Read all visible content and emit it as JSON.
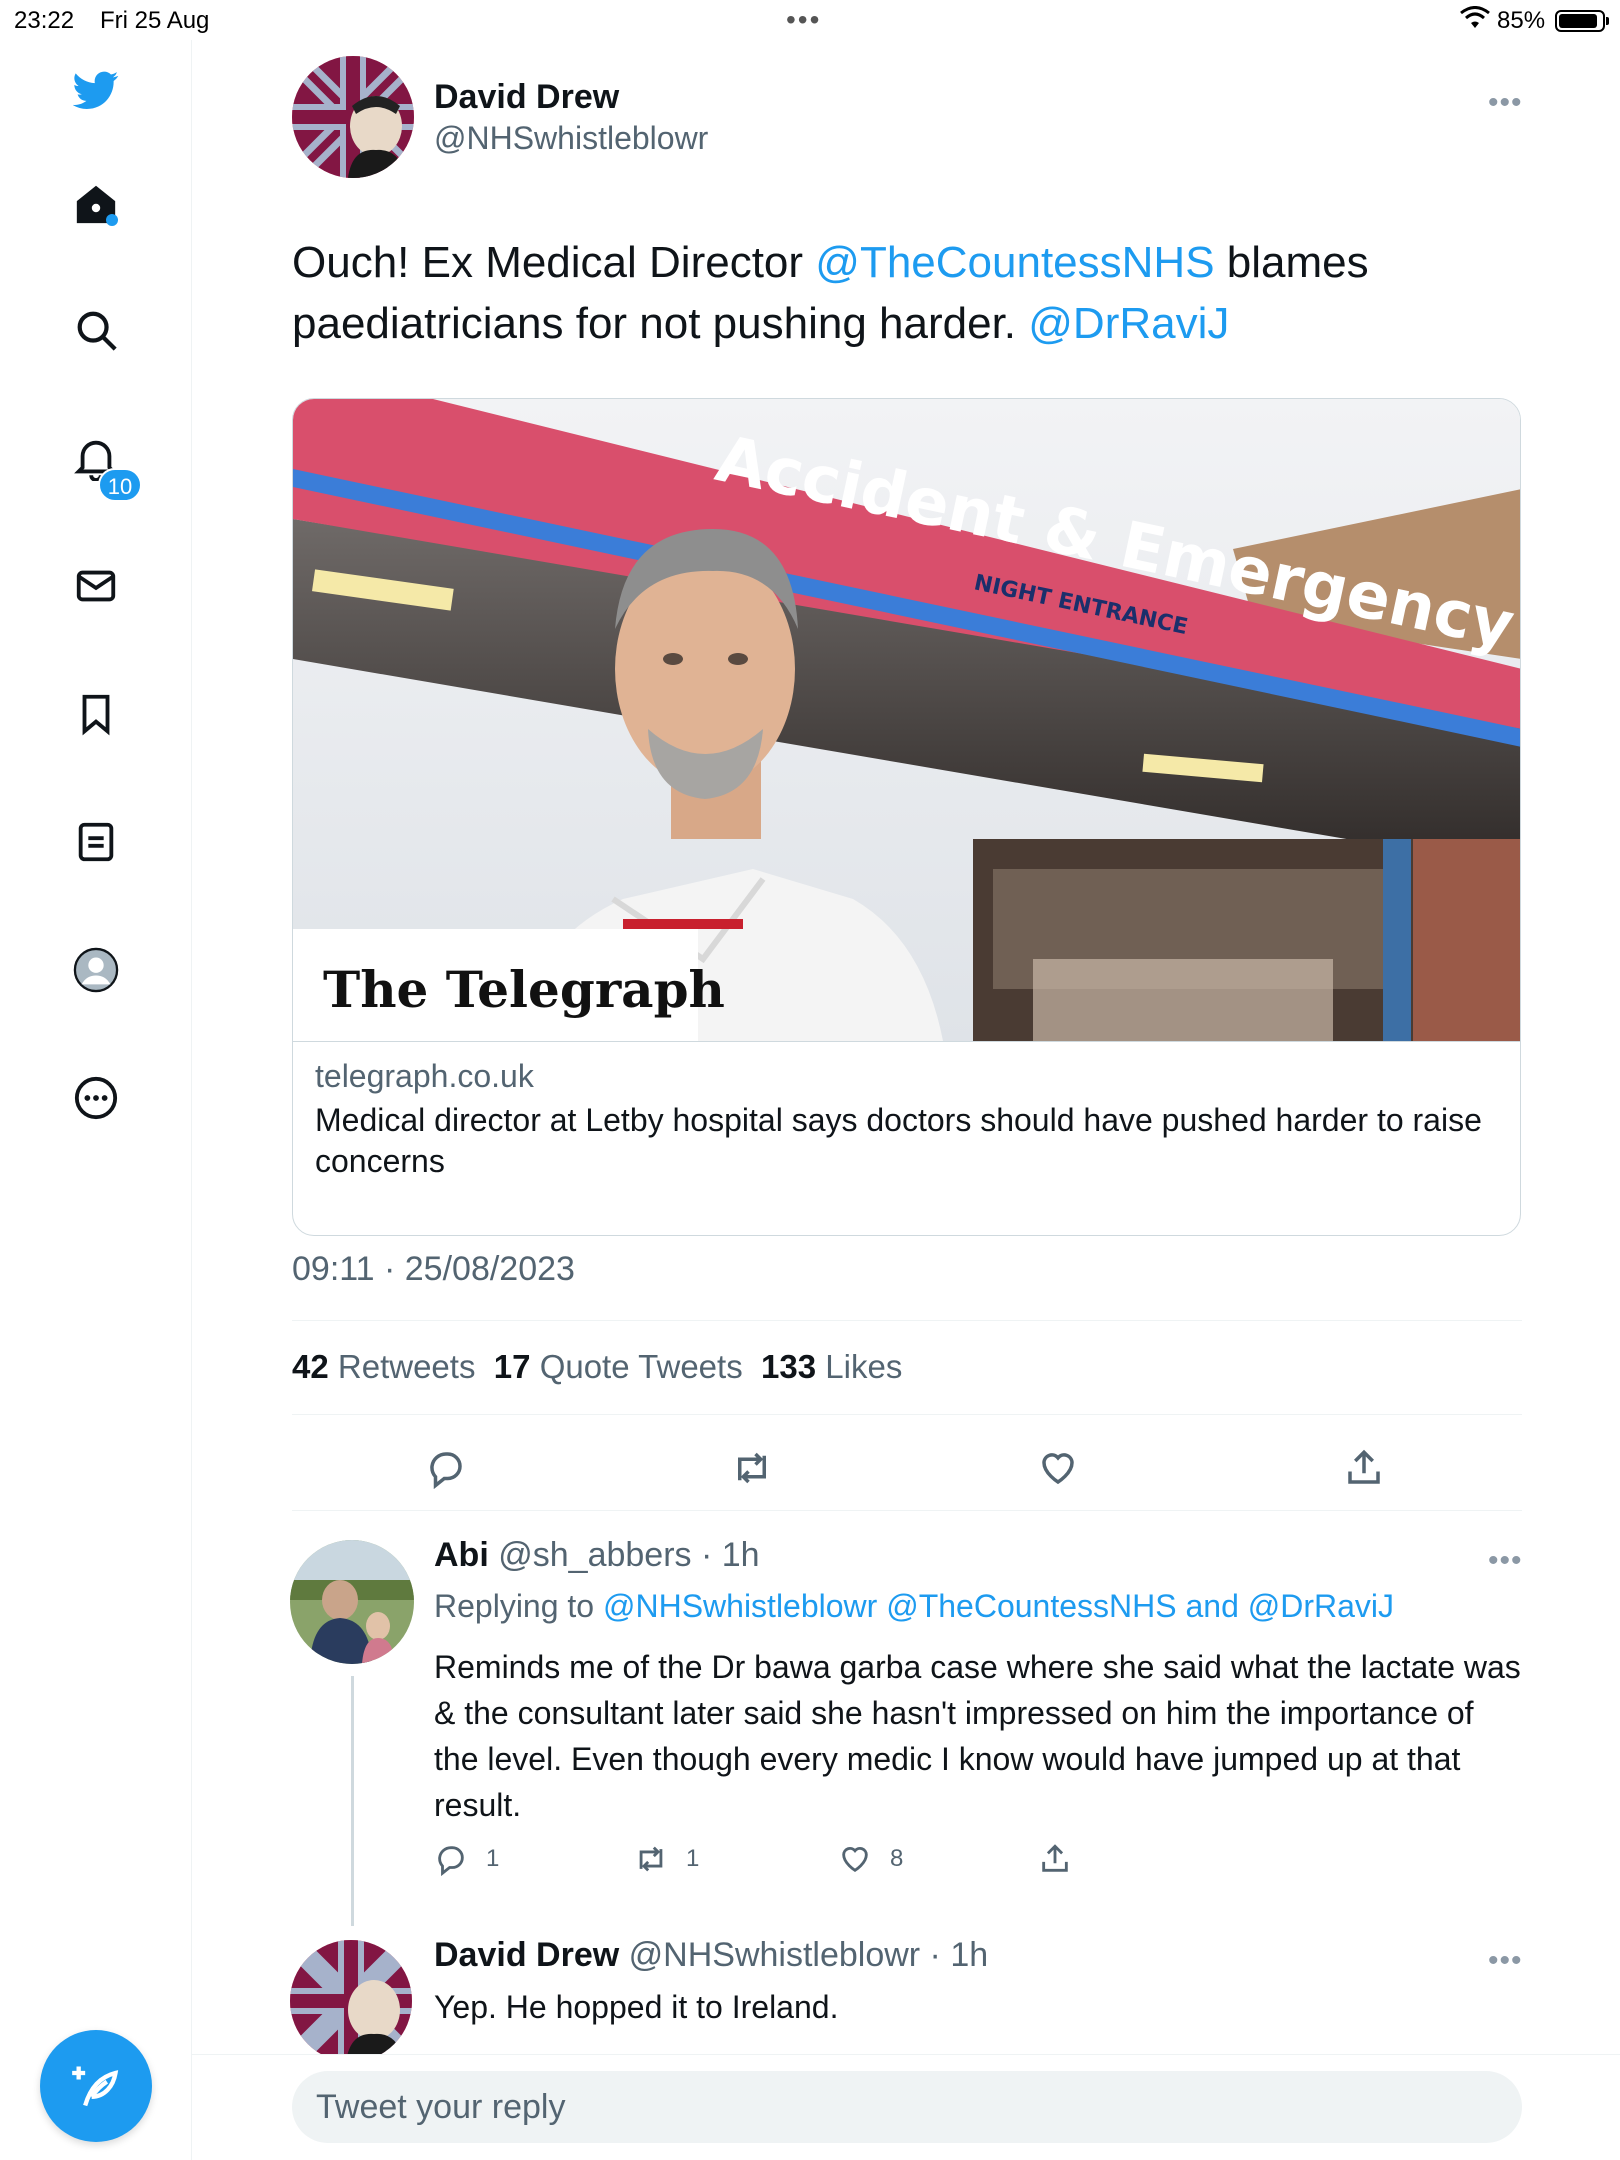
{
  "status_bar": {
    "time": "23:22",
    "date": "Fri 25 Aug",
    "battery": "85%"
  },
  "sidebar": {
    "notifications_badge": "10"
  },
  "tweet": {
    "author_name": "David Drew",
    "author_handle": "@NHSwhistleblowr",
    "text_1": "Ouch! Ex Medical Director ",
    "mention_1": "@TheCountessNHS",
    "text_2": " blames paediatricians for not pushing harder. ",
    "mention_2": "@DrRaviJ",
    "card": {
      "image_sign": "Accident & Emergency",
      "image_subsign": "NIGHT ENTRANCE",
      "image_logo": "The Telegraph",
      "domain": "telegraph.co.uk",
      "title": "Medical director at Letby hospital says doctors should have pushed harder to raise concerns"
    },
    "timestamp": "09:11 · 25/08/2023",
    "stats": {
      "retweets_count": "42",
      "retweets_label": "Retweets",
      "quotes_count": "17",
      "quotes_label": "Quote Tweets",
      "likes_count": "133",
      "likes_label": "Likes"
    }
  },
  "replies": [
    {
      "name": "Abi",
      "handle_time": "@sh_abbers · 1h",
      "replying_label": "Replying to ",
      "replying_mentions": "@NHSwhistleblowr @TheCountessNHS and @DrRaviJ",
      "text": "Reminds me of the Dr bawa garba case where she said what the lactate was & the consultant later said she hasn't impressed on him the importance of the level. Even though every medic I know would have jumped up at that result.",
      "reply_count": "1",
      "retweet_count": "1",
      "like_count": "8"
    },
    {
      "name": "David Drew",
      "handle_time": "@NHSwhistleblowr · 1h",
      "text": "Yep. He hopped it to Ireland."
    }
  ],
  "reply_bar": {
    "placeholder": "Tweet your reply"
  },
  "colors": {
    "accent": "#1d9bf0",
    "text": "#0f1419",
    "secondary": "#536471"
  }
}
